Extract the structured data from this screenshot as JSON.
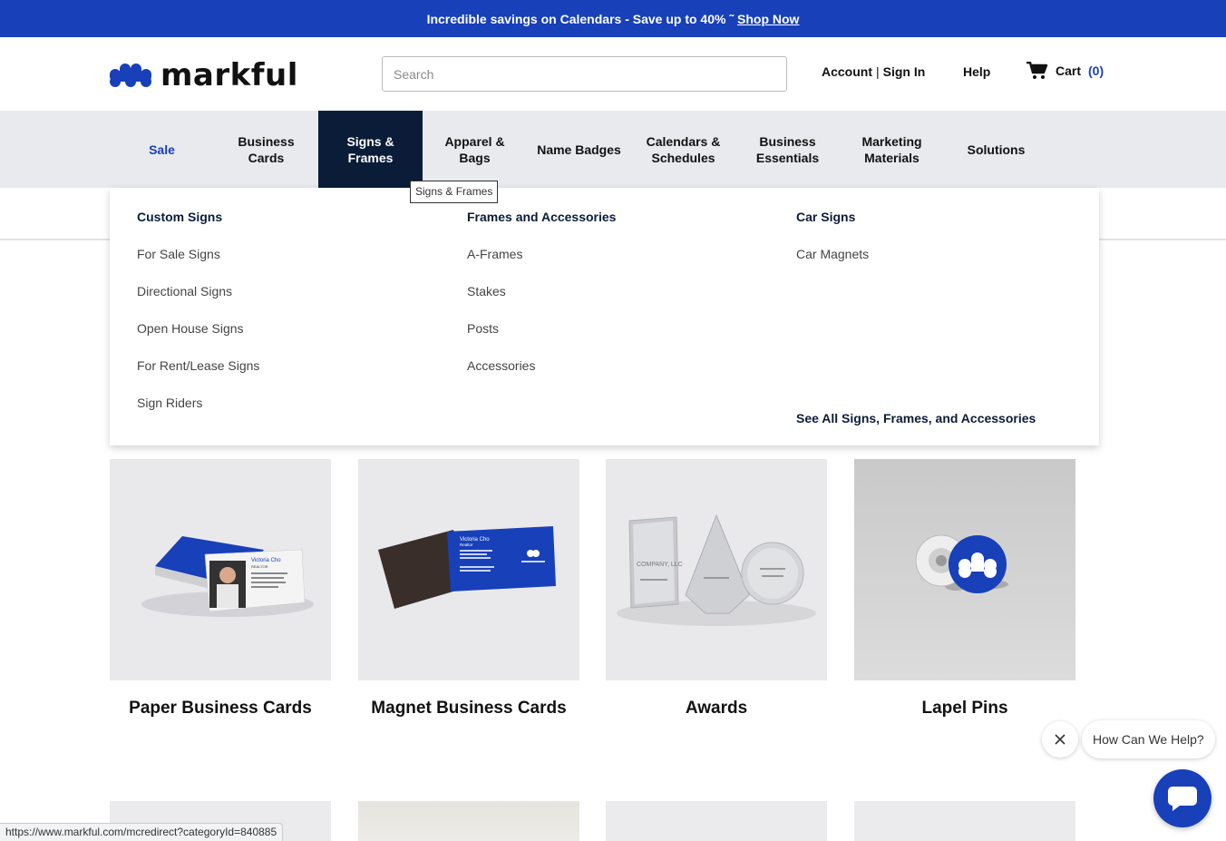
{
  "promo": {
    "text": "Incredible savings on Calendars - Save up to 40% ˜",
    "link": "Shop Now"
  },
  "header": {
    "logo_text": "markful",
    "search_placeholder": "Search",
    "account": "Account",
    "separator": "|",
    "sign_in": "Sign In",
    "help": "Help",
    "cart_label": "Cart",
    "cart_count": "(0)"
  },
  "nav": {
    "items": [
      {
        "label": "Sale"
      },
      {
        "label": "Business Cards"
      },
      {
        "label": "Signs & Frames"
      },
      {
        "label": "Apparel & Bags"
      },
      {
        "label": "Name Badges"
      },
      {
        "label": "Calendars & Schedules"
      },
      {
        "label": "Business Essentials"
      },
      {
        "label": "Marketing Materials"
      },
      {
        "label": "Solutions"
      }
    ],
    "tooltip": "Signs & Frames"
  },
  "dropdown": {
    "columns": [
      {
        "title": "Custom Signs",
        "links": [
          "For Sale Signs",
          "Directional Signs",
          "Open House Signs",
          "For Rent/Lease Signs",
          "Sign Riders"
        ]
      },
      {
        "title": "Frames and Accessories",
        "links": [
          "A-Frames",
          "Stakes",
          "Posts",
          "Accessories"
        ]
      },
      {
        "title": "Car Signs",
        "links": [
          "Car Magnets"
        ]
      }
    ],
    "see_all": "See All Signs, Frames, and Accessories"
  },
  "products": [
    {
      "name": "Paper Business Cards",
      "card_name": "Victoria Cho",
      "card_title": "REALTOR"
    },
    {
      "name": "Magnet Business Cards",
      "card_name": "Victoria Cho",
      "card_title": "Realtor"
    },
    {
      "name": "Awards",
      "award_text": "COMPANY, LLC"
    },
    {
      "name": "Lapel Pins"
    }
  ],
  "chat": {
    "prompt": "How Can We Help?"
  },
  "status_url": "https://www.markful.com/mcredirect?categoryId=840885",
  "colors": {
    "brand_blue": "#1740b9",
    "nav_active": "#0b1c38",
    "nav_bg": "#e9eaee"
  }
}
